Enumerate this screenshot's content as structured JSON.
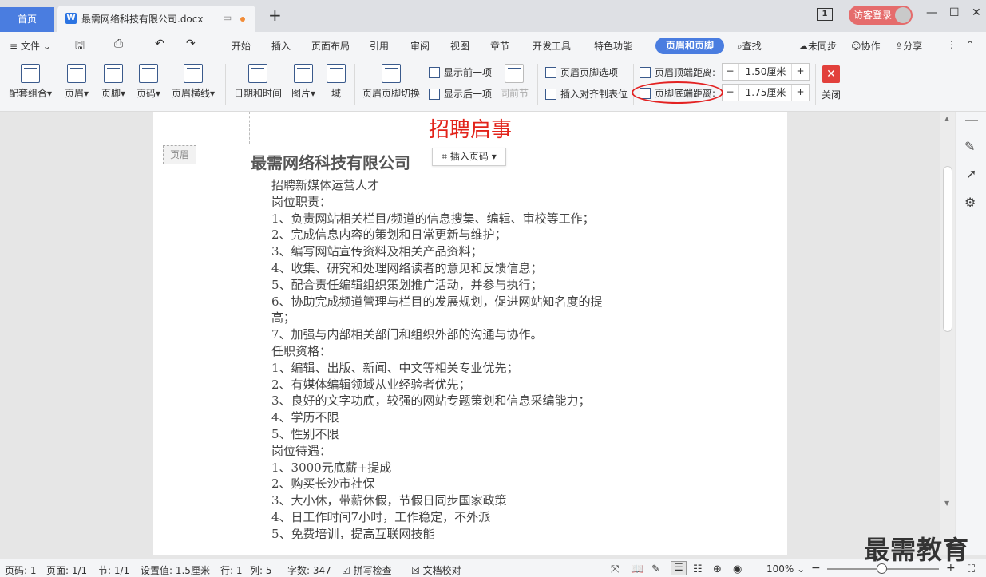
{
  "tabs": {
    "home": "首页",
    "doc_icon": "W",
    "doc_title": "最需网络科技有限公司.docx",
    "add": "+"
  },
  "window": {
    "page_indicator": "1",
    "login": "访客登录",
    "minimize": "—",
    "restore": "☐",
    "close": "✕"
  },
  "menu": {
    "file": "文件",
    "items": [
      "开始",
      "插入",
      "页面布局",
      "引用",
      "审阅",
      "视图",
      "章节",
      "开发工具",
      "特色功能"
    ],
    "active": "页眉和页脚",
    "search": "查找",
    "sync": "未同步",
    "collab": "协作",
    "share": "分享"
  },
  "ribbon": {
    "combo": "配套组合",
    "header": "页眉",
    "footer": "页脚",
    "page_num": "页码",
    "header_line": "页眉横线",
    "datetime": "日期和时间",
    "picture": "图片",
    "field": "域",
    "switch": "页眉页脚切换",
    "show_prev": "显示前一项",
    "show_next": "显示后一项",
    "same_prev": "同前节",
    "options": "页眉页脚选项",
    "insert_align": "插入对齐制表位",
    "header_top_label": "页眉顶端距离:",
    "header_top_value": "1.50厘米",
    "footer_bottom_label": "页脚底端距离:",
    "footer_bottom_value": "1.75厘米",
    "close": "关闭",
    "close_x": "✕"
  },
  "doc": {
    "header_title": "招聘启事",
    "header_tag": "页眉",
    "insert_page_number": "插入页码",
    "company": "最需网络科技有限公司",
    "lines": [
      "招聘新媒体运营人才",
      "岗位职责：",
      "1、负责网站相关栏目/频道的信息搜集、编辑、审校等工作；",
      "2、完成信息内容的策划和日常更新与维护；",
      "3、编写网站宣传资料及相关产品资料；",
      "4、收集、研究和处理网络读者的意见和反馈信息；",
      "5、配合责任编辑组织策划推广活动，并参与执行；",
      "6、协助完成频道管理与栏目的发展规划，促进网站知名度的提",
      "高；",
      "7、加强与内部相关部门和组织外部的沟通与协作。",
      "    任职资格：",
      "1、编辑、出版、新闻、中文等相关专业优先；",
      "2、有媒体编辑领域从业经验者优先；",
      "3、良好的文字功底，较强的网站专题策划和信息采编能力；",
      "4、学历不限",
      "5、性别不限",
      "    岗位待遇：",
      "1、3000元底薪+提成",
      "2、购买长沙市社保",
      "3、大小休，带薪休假，节假日同步国家政策",
      "4、日工作时间7小时，工作稳定，不外派",
      "5、免费培训，提高互联网技能"
    ]
  },
  "status": {
    "page_code": "页码: 1",
    "page": "页面: 1/1",
    "section": "节: 1/1",
    "setting": "设置值: 1.5厘米",
    "row": "行: 1",
    "col": "列: 5",
    "words": "字数: 347",
    "spell": "拼写检查",
    "proof": "文档校对",
    "zoom": "100%",
    "zoom_minus": "−",
    "zoom_plus": "+"
  },
  "watermark": "最需教育"
}
